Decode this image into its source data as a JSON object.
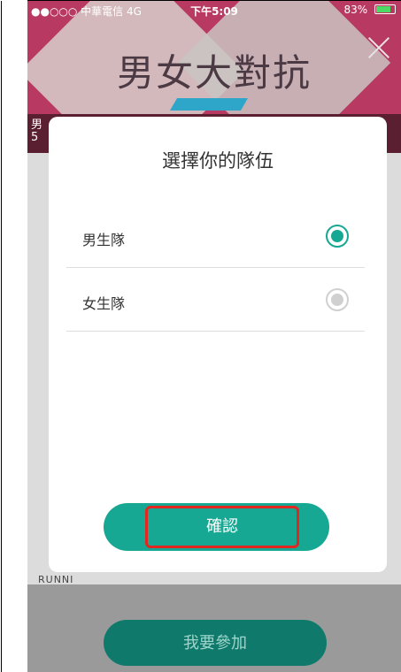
{
  "status_bar": {
    "carrier": "●●○○○ 中華電信 4G",
    "time": "下午5:09",
    "battery": "83%"
  },
  "banner": {
    "title": "男女大對抗"
  },
  "band_text": "男\n5",
  "modal": {
    "title": "選擇你的隊伍",
    "options": [
      {
        "label": "男生隊",
        "selected": true
      },
      {
        "label": "女生隊",
        "selected": false
      }
    ],
    "confirm_label": "確認"
  },
  "background": {
    "peek_text": "RUNNI",
    "join_label": "我要參加"
  },
  "colors": {
    "accent": "#17a893",
    "banner": "#b83a63",
    "highlight": "#e3261f"
  }
}
